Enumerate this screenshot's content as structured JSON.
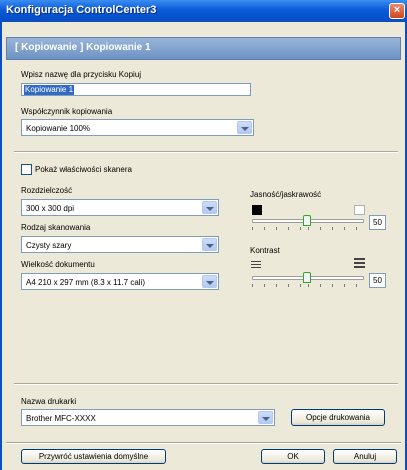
{
  "window": {
    "title": "Konfiguracja ControlCenter3",
    "close_glyph": "×"
  },
  "header": {
    "text": "[ Kopiowanie ]   Kopiowanie 1"
  },
  "name_field": {
    "label": "Wpisz nazwę dla przycisku Kopiuj",
    "value": "Kopiowanie 1"
  },
  "ratio": {
    "label": "Współczynnik kopiowania",
    "value": "Kopiowanie 100%"
  },
  "scanner_props": {
    "label": "Pokaż właściwości skanera",
    "checked": false
  },
  "resolution": {
    "label": "Rozdzielczość",
    "value": "300 x 300 dpi"
  },
  "scan_type": {
    "label": "Rodzaj skanowania",
    "value": "Czysty szary"
  },
  "doc_size": {
    "label": "Wielkość dokumentu",
    "value": "A4 210 x 297 mm (8.3 x 11.7 cali)"
  },
  "brightness": {
    "label": "Jasność/jaskrawość",
    "value": "50"
  },
  "contrast": {
    "label": "Kontrast",
    "value": "50"
  },
  "printer": {
    "label": "Nazwa drukarki",
    "value": "Brother MFC-XXXX",
    "options_button": "Opcje drukowania"
  },
  "footer": {
    "restore_button": "Przywróć ustawienia domyślne",
    "ok_button": "OK",
    "cancel_button": "Anuluj"
  },
  "colors": {
    "titlebar": "#0a5bd8",
    "header": "#7a9bc8",
    "dialog_bg": "#ece9d8",
    "slider_thumb_border": "#2fa52f"
  }
}
